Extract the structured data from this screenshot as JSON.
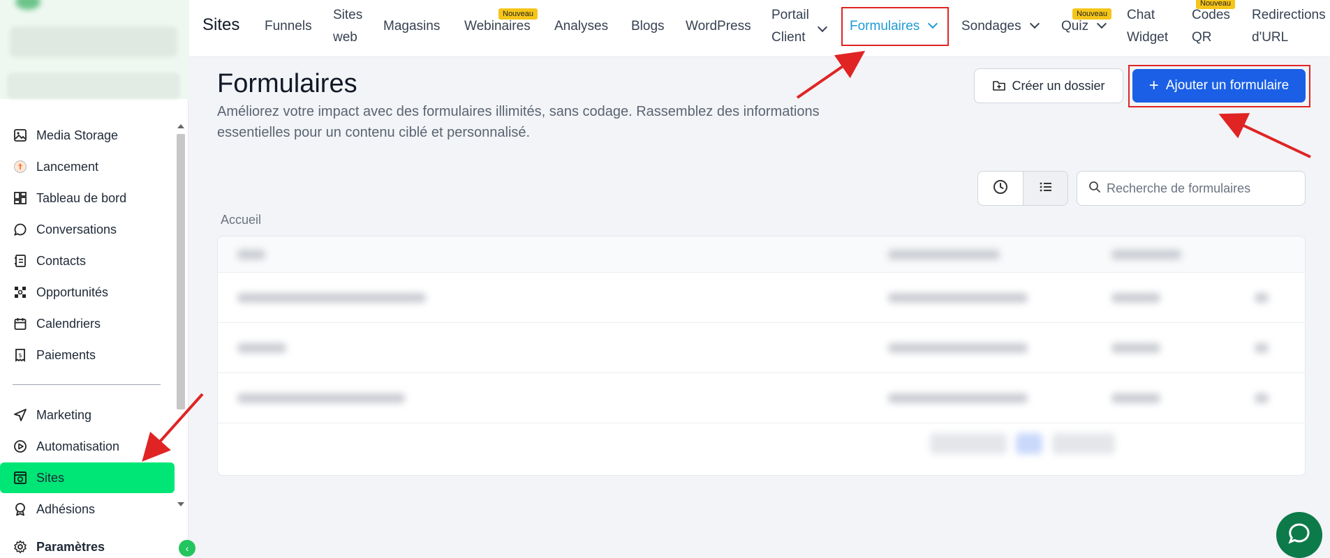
{
  "sidebar": {
    "items": [
      {
        "label": "Media Storage",
        "icon": "image-icon"
      },
      {
        "label": "Lancement",
        "icon": "rocket-icon"
      },
      {
        "label": "Tableau de bord",
        "icon": "dashboard-icon"
      },
      {
        "label": "Conversations",
        "icon": "chat-bubble-icon"
      },
      {
        "label": "Contacts",
        "icon": "contact-book-icon"
      },
      {
        "label": "Opportunités",
        "icon": "network-icon"
      },
      {
        "label": "Calendriers",
        "icon": "calendar-icon"
      },
      {
        "label": "Paiements",
        "icon": "receipt-icon"
      },
      {
        "label": "Marketing",
        "icon": "send-icon"
      },
      {
        "label": "Automatisation",
        "icon": "play-circle-icon"
      },
      {
        "label": "Sites",
        "icon": "globe-window-icon",
        "active": true
      },
      {
        "label": "Adhésions",
        "icon": "badge-icon"
      },
      {
        "label": "Paramètres",
        "icon": "gear-icon"
      }
    ],
    "active_color": "#00e676"
  },
  "topnav": {
    "brand": "Sites",
    "items": [
      {
        "label": "Funnels"
      },
      {
        "label_line1": "Sites",
        "label_line2": "web"
      },
      {
        "label": "Magasins"
      },
      {
        "label": "Webinaires",
        "badge": "Nouveau"
      },
      {
        "label": "Analyses"
      },
      {
        "label": "Blogs"
      },
      {
        "label": "WordPress"
      },
      {
        "label_line1": "Portail",
        "label_line2": "Client"
      },
      {
        "label": "Formulaires",
        "active": true
      },
      {
        "label": "Sondages"
      },
      {
        "label": "Quiz",
        "badge": "Nouveau"
      },
      {
        "label_line1": "Chat",
        "label_line2": "Widget"
      },
      {
        "label_line1": "Codes",
        "label_line2": "QR",
        "badge": "Nouveau"
      },
      {
        "label_line1": "Redirections",
        "label_line2": "d'URL"
      }
    ],
    "active_color": "#1e9bd7"
  },
  "page": {
    "title": "Formulaires",
    "subtitle": "Améliorez votre impact avec des formulaires illimités, sans codage. Rassemblez des informations essentielles pour un contenu ciblé et personnalisé.",
    "create_folder_label": "Créer un dossier",
    "add_form_label": "Ajouter un formulaire",
    "search_placeholder": "Recherche de formulaires",
    "breadcrumb": "Accueil",
    "primary_color": "#1a5fe6",
    "annotation_color": "#e02424"
  }
}
